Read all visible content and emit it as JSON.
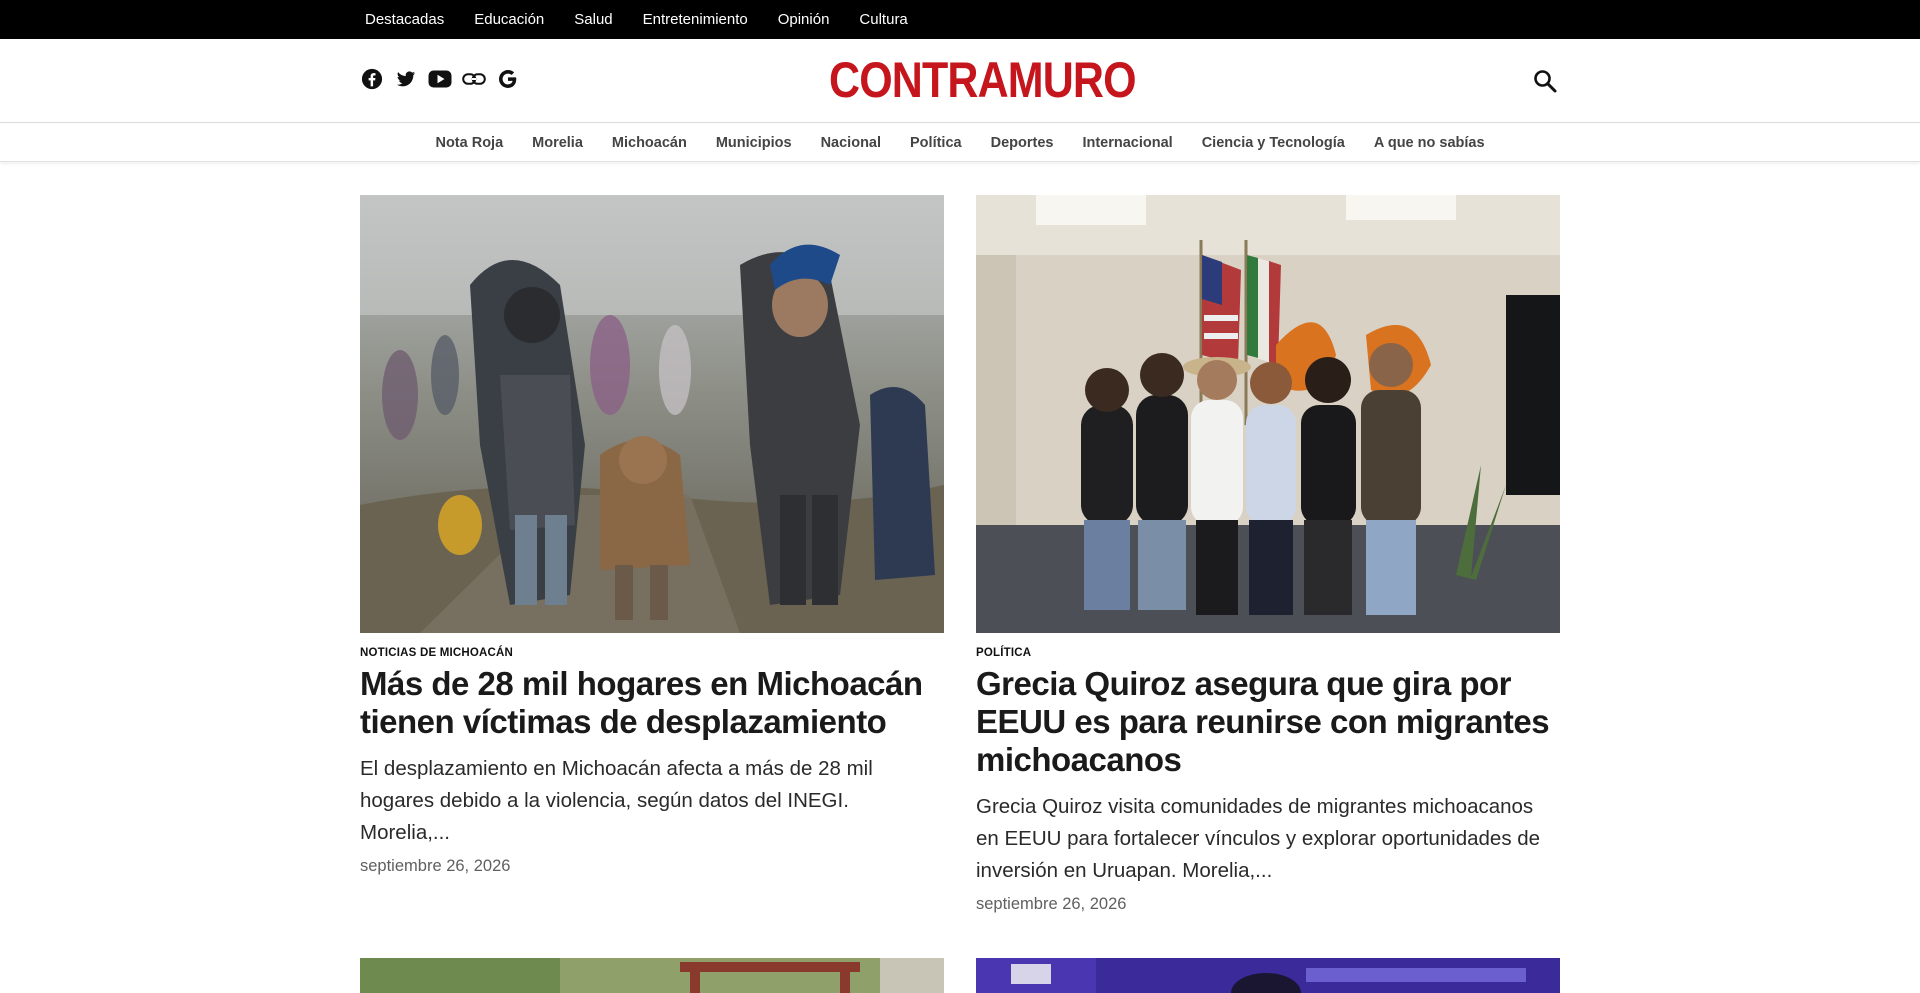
{
  "topbar": {
    "items": [
      "Destacadas",
      "Educación",
      "Salud",
      "Entretenimiento",
      "Opinión",
      "Cultura"
    ]
  },
  "header": {
    "logo_text": "CONTRAMURO",
    "social_icons": [
      "facebook-icon",
      "twitter-icon",
      "youtube-icon",
      "link-icon",
      "google-icon"
    ],
    "search_icon": "search-icon",
    "brand_color": "#c6161d"
  },
  "categories": [
    "Nota Roja",
    "Morelia",
    "Michoacán",
    "Municipios",
    "Nacional",
    "Política",
    "Deportes",
    "Internacional",
    "Ciencia y Tecnología",
    "A que no sabías"
  ],
  "articles": [
    {
      "kicker": "NOTICIAS DE MICHOACÁN",
      "headline": "Más de 28 mil hogares en Michoacán tienen víctimas de desplazamiento",
      "excerpt": "El desplazamiento en Michoacán afecta a más de 28 mil hogares debido a la violencia, según datos del INEGI. Morelia,...",
      "date": "septiembre 26, 2026"
    },
    {
      "kicker": "POLÍTICA",
      "headline": "Grecia Quiroz asegura que gira por EEUU es para reunirse con migrantes michoacanos",
      "excerpt": "Grecia Quiroz visita comunidades de migrantes michoacanos en EEUU para fortalecer vínculos y explorar oportunidades de inversión en Uruapan. Morelia,...",
      "date": "septiembre 26, 2026"
    }
  ]
}
